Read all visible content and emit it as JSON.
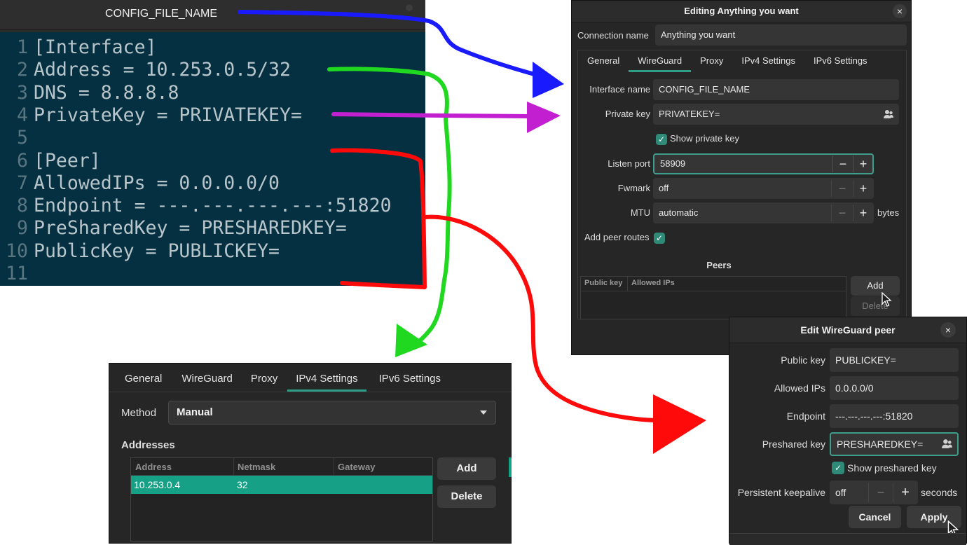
{
  "editor": {
    "title": "CONFIG_FILE_NAME",
    "lines": [
      {
        "n": "1",
        "text": "[Interface]"
      },
      {
        "n": "2",
        "text": "Address = 10.253.0.5/32"
      },
      {
        "n": "3",
        "text": "DNS = 8.8.8.8"
      },
      {
        "n": "4",
        "text": "PrivateKey = PRIVATEKEY="
      },
      {
        "n": "5",
        "text": ""
      },
      {
        "n": "6",
        "text": "[Peer]"
      },
      {
        "n": "7",
        "text": "AllowedIPs = 0.0.0.0/0"
      },
      {
        "n": "8",
        "text": "Endpoint = ---.---.---.---:51820"
      },
      {
        "n": "9",
        "text": "PreSharedKey = PRESHAREDKEY="
      },
      {
        "n": "10",
        "text": "PublicKey = PUBLICKEY="
      },
      {
        "n": "11",
        "text": ""
      }
    ]
  },
  "edit_dialog": {
    "title": "Editing Anything you want",
    "close": "×",
    "connection_name_label": "Connection name",
    "connection_name": "Anything you want",
    "tabs": [
      "General",
      "WireGuard",
      "Proxy",
      "IPv4 Settings",
      "IPv6 Settings"
    ],
    "active_tab": "WireGuard",
    "interface_name_label": "Interface name",
    "interface_name": "CONFIG_FILE_NAME",
    "private_key_label": "Private key",
    "private_key": "PRIVATEKEY=",
    "show_private_key": "Show private key",
    "listen_port_label": "Listen port",
    "listen_port": "58909",
    "fwmark_label": "Fwmark",
    "fwmark": "off",
    "mtu_label": "MTU",
    "mtu": "automatic",
    "mtu_unit": "bytes",
    "add_peer_routes": "Add peer routes",
    "peers_heading": "Peers",
    "peers_columns": [
      "Public key",
      "Allowed IPs"
    ],
    "add_button": "Add",
    "delete_button": "Delete",
    "minus": "−",
    "plus": "+"
  },
  "ipv4_panel": {
    "tabs": [
      "General",
      "WireGuard",
      "Proxy",
      "IPv4 Settings",
      "IPv6 Settings"
    ],
    "active_tab": "IPv4 Settings",
    "method_label": "Method",
    "method": "Manual",
    "addresses_heading": "Addresses",
    "columns": [
      "Address",
      "Netmask",
      "Gateway"
    ],
    "rows": [
      {
        "address": "10.253.0.4",
        "netmask": "32",
        "gateway": ""
      }
    ],
    "add_button": "Add",
    "delete_button": "Delete"
  },
  "peer_dialog": {
    "title": "Edit WireGuard peer",
    "close": "×",
    "public_key_label": "Public key",
    "public_key": "PUBLICKEY=",
    "allowed_ips_label": "Allowed IPs",
    "allowed_ips": "0.0.0.0/0",
    "endpoint_label": "Endpoint",
    "endpoint": "---.---.---.---:51820",
    "preshared_key_label": "Preshared key",
    "preshared_key": "PRESHAREDKEY=",
    "show_preshared_key": "Show preshared key",
    "keepalive_label": "Persistent keepalive",
    "keepalive": "off",
    "keepalive_unit": "seconds",
    "cancel_button": "Cancel",
    "apply_button": "Apply",
    "minus": "−",
    "plus": "+"
  },
  "colors": {
    "accent": "#2f9e86",
    "selection_row": "#16a085",
    "arrow_blue": "#1a1aff",
    "arrow_green": "#1fd81f",
    "arrow_purple": "#c21fd0",
    "arrow_red": "#ff0a0a",
    "code_background": "#043041"
  }
}
